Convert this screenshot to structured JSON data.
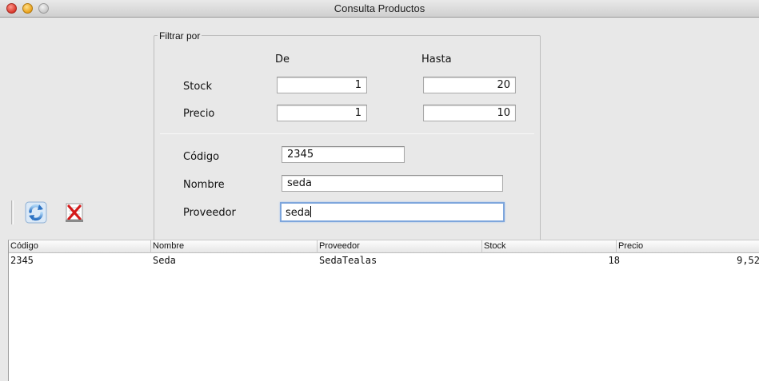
{
  "window": {
    "title": "Consulta Productos"
  },
  "filter": {
    "legend": "Filtrar por",
    "col_from": "De",
    "col_to": "Hasta",
    "stock": {
      "label": "Stock",
      "from": "1",
      "to": "20"
    },
    "precio": {
      "label": "Precio",
      "from": "1",
      "to": "10"
    },
    "codigo": {
      "label": "Código",
      "value": "2345"
    },
    "nombre": {
      "label": "Nombre",
      "value": "seda"
    },
    "proveedor": {
      "label": "Proveedor",
      "value": "seda"
    }
  },
  "toolbar": {
    "refresh_icon": "refresh-icon",
    "clear_icon": "clear-filter-icon"
  },
  "table": {
    "columns": [
      "Código",
      "Nombre",
      "Proveedor",
      "Stock",
      "Precio"
    ],
    "rows": [
      [
        "2345",
        "Seda",
        "SedaTealas",
        "18",
        "9,52"
      ]
    ]
  }
}
